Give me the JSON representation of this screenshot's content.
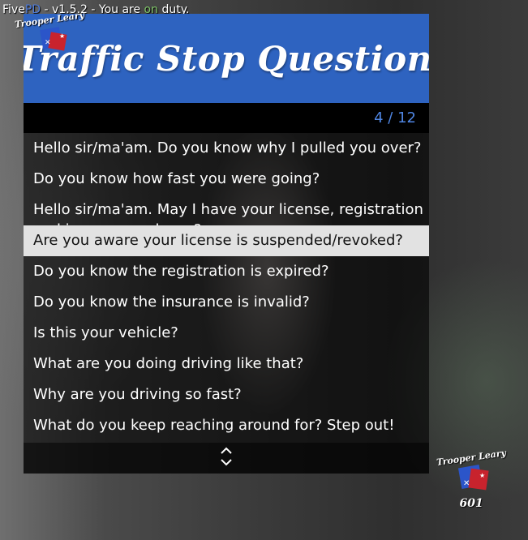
{
  "status_bar": {
    "prefix": "Five",
    "pd": "PD",
    "middle": " - v1.5.2 - You are ",
    "state": "on",
    "suffix": " duty."
  },
  "menu": {
    "title": "Traffic Stop Questions",
    "counter": "4 / 12",
    "items": [
      {
        "label": "Hello sir/ma'am. Do you know why I pulled you over?"
      },
      {
        "label": "Do you know how fast you were going?"
      },
      {
        "label": "Hello sir/ma'am. May I have your license, registration and insurance, please?"
      },
      {
        "label": "Are you aware your license is suspended/revoked?"
      },
      {
        "label": "Do you know the registration is expired?"
      },
      {
        "label": "Do you know the insurance is invalid?"
      },
      {
        "label": "Is this your vehicle?"
      },
      {
        "label": "What are you doing driving like that?"
      },
      {
        "label": "Why are you driving so fast?"
      },
      {
        "label": "What do you keep reaching around for? Step out!"
      }
    ],
    "selected_index": 3,
    "scroll_icon": "up-down-arrows-icon"
  },
  "watermark": {
    "name": "Trooper Leary",
    "number": "601"
  },
  "colors": {
    "banner": "#2e63c0",
    "counter": "#4f86e3",
    "selected_bg": "#e2e2e2"
  }
}
